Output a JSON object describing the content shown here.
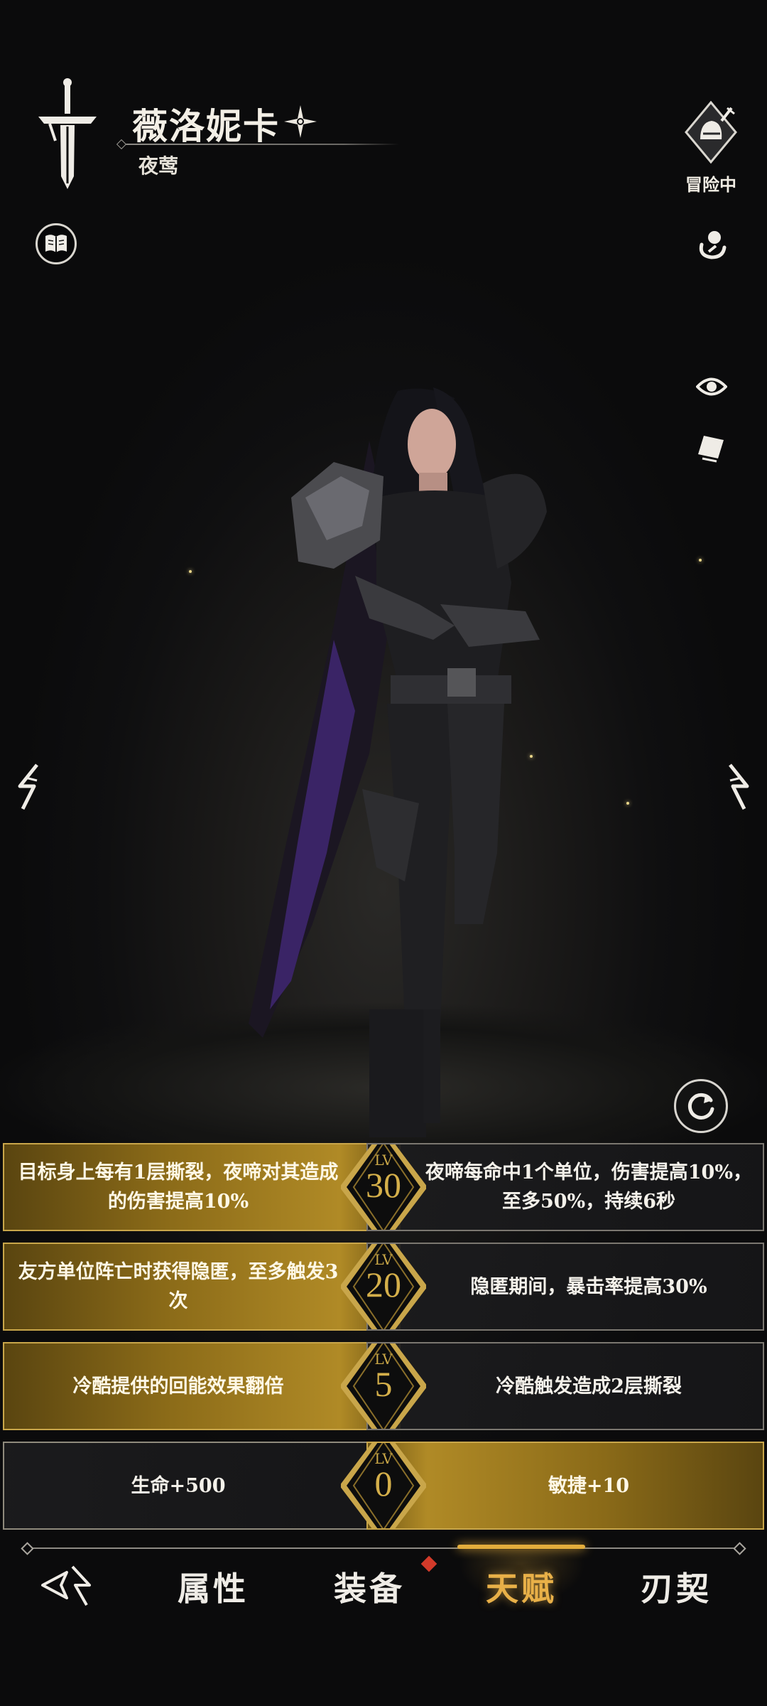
{
  "hero": {
    "name": "薇洛妮卡",
    "class": "夜莺",
    "status": "冒险中"
  },
  "icons": {
    "dagger": "dagger-icon",
    "star": "four-point-star-icon",
    "book": "book-icon",
    "status": "knight-helmet-badge-icon",
    "skin": "skin-palette-icon",
    "view": "eye-icon",
    "card": "card-icon",
    "prev": "prev-hero-arrow-icon",
    "next": "next-hero-arrow-icon",
    "refresh": "refresh-icon"
  },
  "talents": [
    {
      "lv_tag": "LV",
      "level": "30",
      "left": "目标身上每有1层撕裂，夜啼对其造成的伤害提高10%",
      "right": "夜啼每命中1个单位，伤害提高10%，至多50%，持续6秒",
      "selected": "left"
    },
    {
      "lv_tag": "LV",
      "level": "20",
      "left": "友方单位阵亡时获得隐匿，至多触发3次",
      "right": "隐匿期间，暴击率提高30%",
      "selected": "left"
    },
    {
      "lv_tag": "LV",
      "level": "5",
      "left": "冷酷提供的回能效果翻倍",
      "right": "冷酷触发造成2层撕裂",
      "selected": "left"
    },
    {
      "lv_tag": "LV",
      "level": "0",
      "left": "生命+500",
      "right": "敏捷+10",
      "selected": "right"
    }
  ],
  "nav": {
    "items": [
      "属性",
      "装备",
      "天赋",
      "刃契"
    ],
    "active": "天赋"
  },
  "colors": {
    "gold": "#b08a26",
    "accent": "#e8b048",
    "badge_red": "#d23a2a"
  }
}
